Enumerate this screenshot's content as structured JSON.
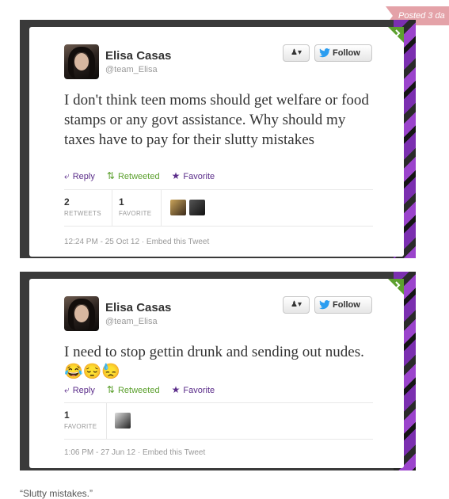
{
  "post_label": "Posted 3 da",
  "caption": "“Slutty mistakes.”",
  "tweets": [
    {
      "name": "Elisa Casas",
      "handle": "@team_Elisa",
      "follow_label": "Follow",
      "text": "I don't think teen moms should get welfare or food stamps or any govt assistance. Why should my taxes have to pay for their slutty mistakes",
      "reply_label": "Reply",
      "retweeted_label": "Retweeted",
      "favorite_label": "Favorite",
      "retweets_count": "2",
      "retweets_label": "RETWEETS",
      "favorites_count": "1",
      "favorites_label": "FAVORITE",
      "meta": "12:24 PM - 25 Oct 12 · Embed this Tweet"
    },
    {
      "name": "Elisa Casas",
      "handle": "@team_Elisa",
      "follow_label": "Follow",
      "text": "I need to stop gettin drunk and sending out nudes. 😂😔😓",
      "reply_label": "Reply",
      "retweeted_label": "Retweeted",
      "favorite_label": "Favorite",
      "favorites_count": "1",
      "favorites_label": "FAVORITE",
      "meta": "1:06 PM - 27 Jun 12 · Embed this Tweet"
    }
  ],
  "colors": {
    "accent_purple": "#5b2d8a",
    "retweet_green": "#5ca02e",
    "follow_blue": "#2b9df0"
  }
}
